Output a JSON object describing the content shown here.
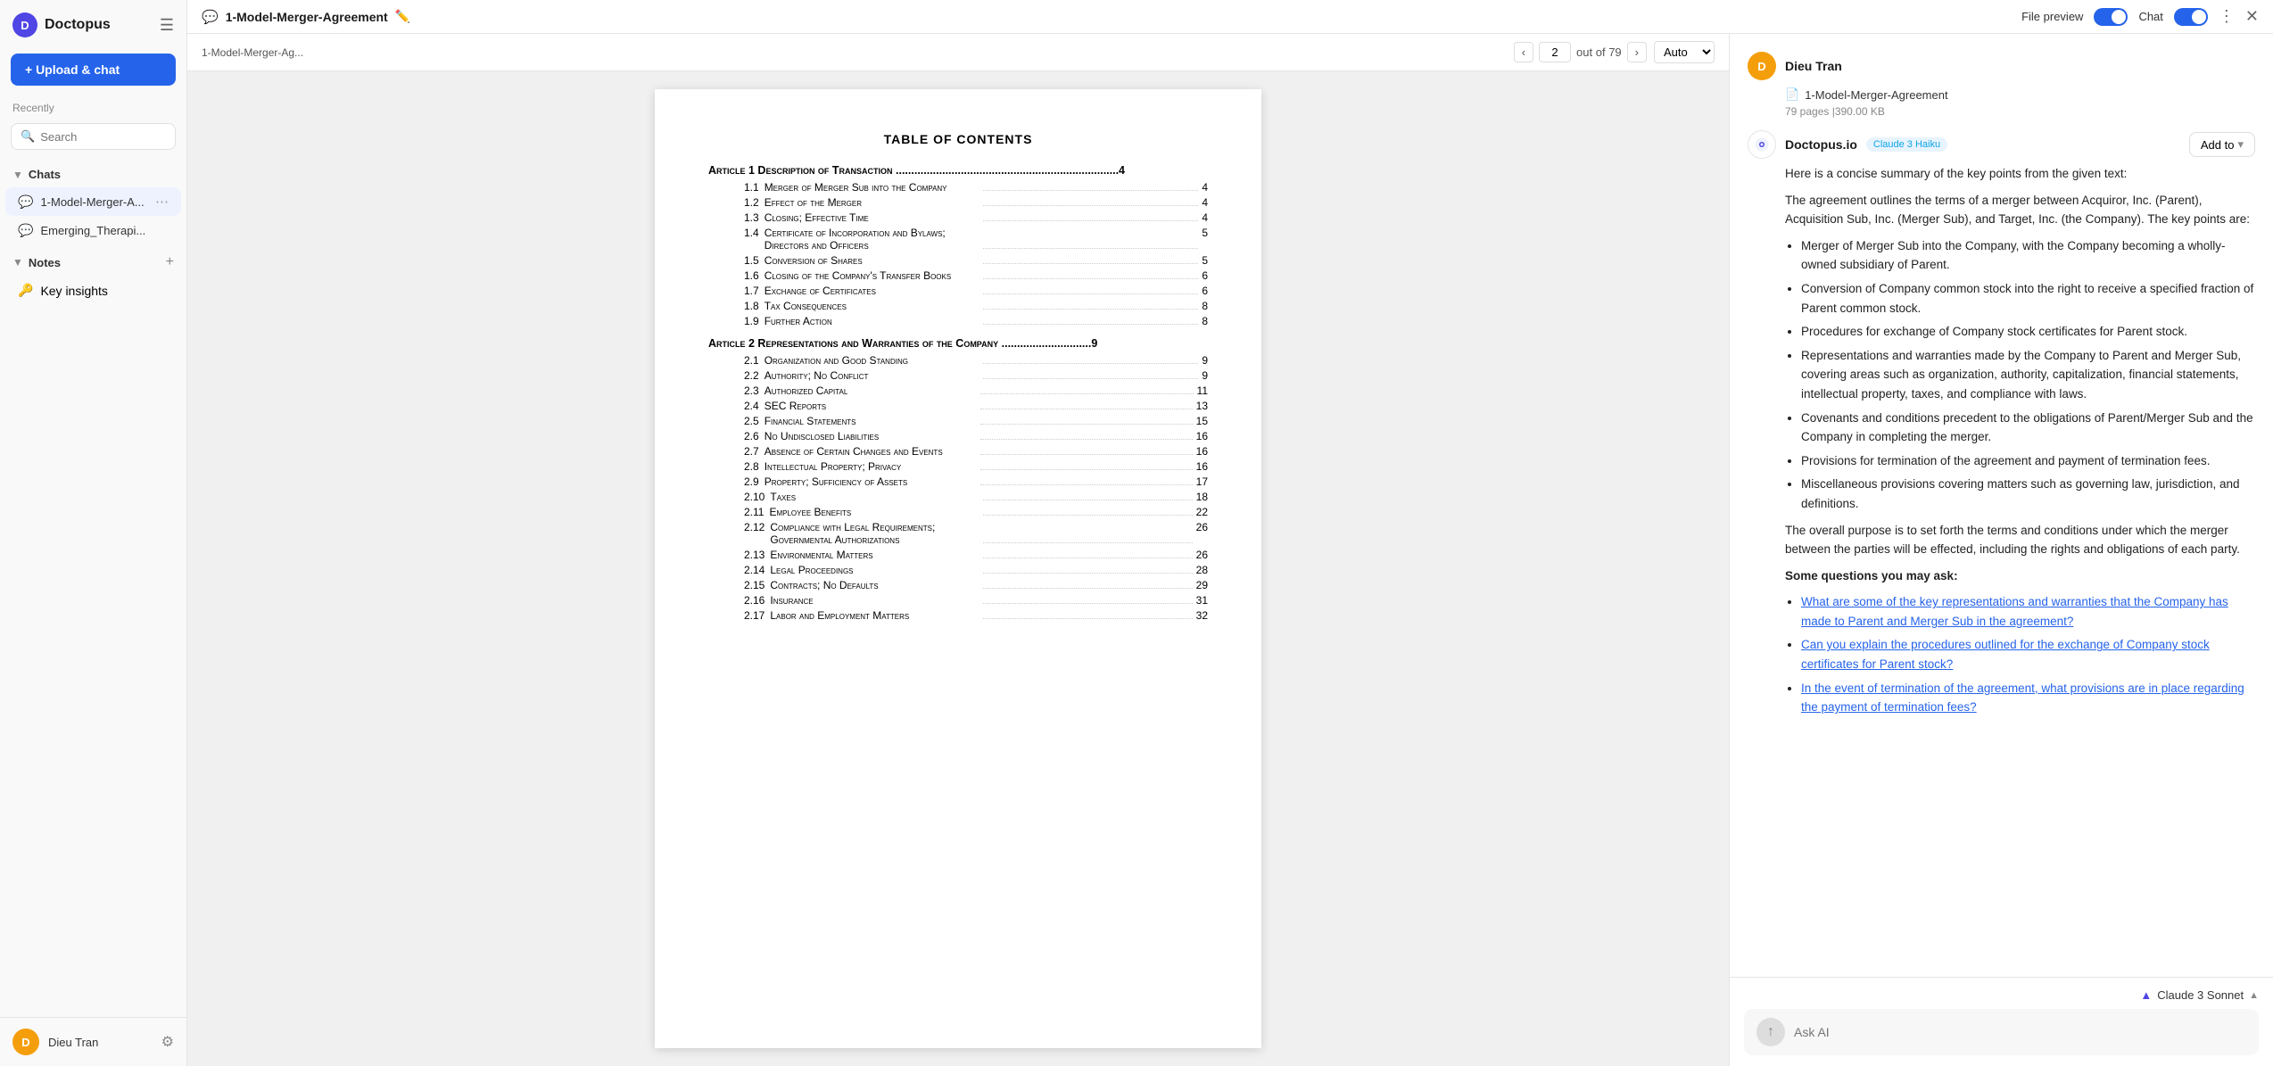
{
  "app": {
    "name": "Doctopus"
  },
  "sidebar": {
    "upload_label": "+ Upload & chat",
    "recently_label": "Recently",
    "search_placeholder": "Search",
    "chats_label": "Chats",
    "chats": [
      {
        "id": "chat1",
        "label": "1-Model-Merger-A...",
        "active": true
      },
      {
        "id": "chat2",
        "label": "Emerging_Therapi...",
        "active": false
      }
    ],
    "notes_label": "Notes",
    "key_insights_label": "Key insights",
    "user": {
      "name": "Dieu Tran",
      "initials": "D"
    }
  },
  "topbar": {
    "doc_title": "1-Model-Merger-Agreement",
    "file_preview_label": "File preview",
    "chat_label": "Chat",
    "toggle_file_preview": true,
    "toggle_chat": true
  },
  "pdf": {
    "filename": "1-Model-Merger-Ag...",
    "current_page": "2",
    "total_pages": "79",
    "zoom": "Auto",
    "toc_title": "TABLE OF CONTENTS",
    "articles": [
      {
        "title": "Article 1 Description of Transaction",
        "page": "4",
        "items": [
          {
            "num": "1.1",
            "label": "Merger of Merger Sub into the Company",
            "page": "4"
          },
          {
            "num": "1.2",
            "label": "Effect of the Merger",
            "page": "4"
          },
          {
            "num": "1.3",
            "label": "Closing; Effective Time",
            "page": "4"
          },
          {
            "num": "1.4",
            "label": "Certificate of Incorporation and Bylaws; Directors and Officers",
            "page": "5"
          },
          {
            "num": "1.5",
            "label": "Conversion of Shares",
            "page": "5"
          },
          {
            "num": "1.6",
            "label": "Closing of the Company's Transfer Books",
            "page": "6"
          },
          {
            "num": "1.7",
            "label": "Exchange of Certificates",
            "page": "6"
          },
          {
            "num": "1.8",
            "label": "Tax Consequences",
            "page": "8"
          },
          {
            "num": "1.9",
            "label": "Further Action",
            "page": "8"
          }
        ]
      },
      {
        "title": "Article 2 Representations and Warranties of the Company",
        "page": "9",
        "items": [
          {
            "num": "2.1",
            "label": "Organization and Good Standing",
            "page": "9"
          },
          {
            "num": "2.2",
            "label": "Authority; No Conflict",
            "page": "9"
          },
          {
            "num": "2.3",
            "label": "Authorized Capital",
            "page": "11"
          },
          {
            "num": "2.4",
            "label": "SEC Reports",
            "page": "13"
          },
          {
            "num": "2.5",
            "label": "Financial Statements",
            "page": "15"
          },
          {
            "num": "2.6",
            "label": "No Undisclosed Liabilities",
            "page": "16"
          },
          {
            "num": "2.7",
            "label": "Absence of Certain Changes and Events",
            "page": "16"
          },
          {
            "num": "2.8",
            "label": "Intellectual Property; Privacy",
            "page": "16"
          },
          {
            "num": "2.9",
            "label": "Property; Sufficiency of Assets",
            "page": "17"
          },
          {
            "num": "2.10",
            "label": "Taxes",
            "page": "18"
          },
          {
            "num": "2.11",
            "label": "Employee Benefits",
            "page": "22"
          },
          {
            "num": "2.12",
            "label": "Compliance with Legal Requirements; Governmental Authorizations",
            "page": "26"
          },
          {
            "num": "2.13",
            "label": "Environmental Matters",
            "page": "26"
          },
          {
            "num": "2.14",
            "label": "Legal Proceedings",
            "page": "28"
          },
          {
            "num": "2.15",
            "label": "Contracts; No Defaults",
            "page": "29"
          },
          {
            "num": "2.16",
            "label": "Insurance",
            "page": "31"
          },
          {
            "num": "2.17",
            "label": "Labor and Employment Matters",
            "page": "32"
          }
        ]
      }
    ]
  },
  "chat": {
    "user": {
      "name": "Dieu Tran",
      "initials": "D"
    },
    "document": {
      "name": "1-Model-Merger-Agreement",
      "meta": "79 pages |390.00 KB"
    },
    "ai": {
      "name": "Doctopus.io",
      "model": "Claude 3 Haiku"
    },
    "add_to_label": "Add to",
    "summary_intro": "Here is a concise summary of the key points from the given text:",
    "summary_para": "The agreement outlines the terms of a merger between Acquiror, Inc. (Parent), Acquisition Sub, Inc. (Merger Sub), and Target, Inc. (the Company). The key points are:",
    "bullet_points": [
      "Merger of Merger Sub into the Company, with the Company becoming a wholly-owned subsidiary of Parent.",
      "Conversion of Company common stock into the right to receive a specified fraction of Parent common stock.",
      "Procedures for exchange of Company stock certificates for Parent stock.",
      "Representations and warranties made by the Company to Parent and Merger Sub, covering areas such as organization, authority, capitalization, financial statements, intellectual property, taxes, and compliance with laws.",
      "Covenants and conditions precedent to the obligations of Parent/Merger Sub and the Company in completing the merger.",
      "Provisions for termination of the agreement and payment of termination fees.",
      "Miscellaneous provisions covering matters such as governing law, jurisdiction, and definitions."
    ],
    "overall_purpose": "The overall purpose is to set forth the terms and conditions under which the merger between the parties will be effected, including the rights and obligations of each party.",
    "suggested_questions_label": "Some questions you may ask:",
    "suggested_questions": [
      "What are some of the key representations and warranties that the Company has made to Parent and Merger Sub in the agreement?",
      "Can you explain the procedures outlined for the exchange of Company stock certificates for Parent stock?",
      "In the event of termination of the agreement, what provisions are in place regarding the payment of termination fees?"
    ],
    "model_selector": "Claude 3 Sonnet",
    "input_placeholder": "Ask AI"
  }
}
